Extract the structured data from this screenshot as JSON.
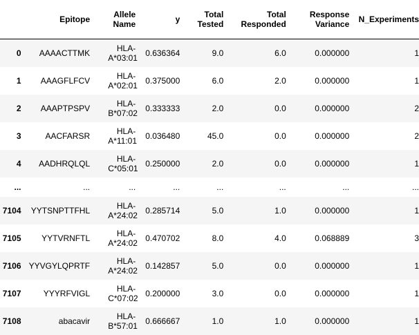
{
  "table": {
    "columns": [
      {
        "key": "index",
        "label": ""
      },
      {
        "key": "epitope",
        "label": "Epitope"
      },
      {
        "key": "allele_name",
        "label": "Allele Name"
      },
      {
        "key": "y",
        "label": "y"
      },
      {
        "key": "total_tested",
        "label": "Total Tested"
      },
      {
        "key": "total_responded",
        "label": "Total Responded"
      },
      {
        "key": "response_variance",
        "label": "Response Variance"
      },
      {
        "key": "n_experiments",
        "label": "N_Experiments"
      }
    ],
    "rows": [
      {
        "index": "0",
        "epitope": "AAAACTTMK",
        "allele_name": "HLA-A*03:01",
        "y": "0.636364",
        "total_tested": "9.0",
        "total_responded": "6.0",
        "response_variance": "0.000000",
        "n_experiments": "1"
      },
      {
        "index": "1",
        "epitope": "AAAGFLFCV",
        "allele_name": "HLA-A*02:01",
        "y": "0.375000",
        "total_tested": "6.0",
        "total_responded": "2.0",
        "response_variance": "0.000000",
        "n_experiments": "1"
      },
      {
        "index": "2",
        "epitope": "AAAPTPSPV",
        "allele_name": "HLA-B*07:02",
        "y": "0.333333",
        "total_tested": "2.0",
        "total_responded": "0.0",
        "response_variance": "0.000000",
        "n_experiments": "2"
      },
      {
        "index": "3",
        "epitope": "AACFARSR",
        "allele_name": "HLA-A*11:01",
        "y": "0.036480",
        "total_tested": "45.0",
        "total_responded": "0.0",
        "response_variance": "0.000000",
        "n_experiments": "2"
      },
      {
        "index": "4",
        "epitope": "AADHRQLQL",
        "allele_name": "HLA-C*05:01",
        "y": "0.250000",
        "total_tested": "2.0",
        "total_responded": "0.0",
        "response_variance": "0.000000",
        "n_experiments": "1"
      },
      {
        "index": "...",
        "epitope": "...",
        "allele_name": "...",
        "y": "...",
        "total_tested": "...",
        "total_responded": "...",
        "response_variance": "...",
        "n_experiments": "..."
      },
      {
        "index": "7104",
        "epitope": "YYTSNPTTFHL",
        "allele_name": "HLA-A*24:02",
        "y": "0.285714",
        "total_tested": "5.0",
        "total_responded": "1.0",
        "response_variance": "0.000000",
        "n_experiments": "1"
      },
      {
        "index": "7105",
        "epitope": "YYTVRNFTL",
        "allele_name": "HLA-A*24:02",
        "y": "0.470702",
        "total_tested": "8.0",
        "total_responded": "4.0",
        "response_variance": "0.068889",
        "n_experiments": "3"
      },
      {
        "index": "7106",
        "epitope": "YYVGYLQPRTF",
        "allele_name": "HLA-A*24:02",
        "y": "0.142857",
        "total_tested": "5.0",
        "total_responded": "0.0",
        "response_variance": "0.000000",
        "n_experiments": "1"
      },
      {
        "index": "7107",
        "epitope": "YYYRFVIGL",
        "allele_name": "HLA-C*07:02",
        "y": "0.200000",
        "total_tested": "3.0",
        "total_responded": "0.0",
        "response_variance": "0.000000",
        "n_experiments": "1"
      },
      {
        "index": "7108",
        "epitope": "abacavir",
        "allele_name": "HLA-B*57:01",
        "y": "0.666667",
        "total_tested": "1.0",
        "total_responded": "1.0",
        "response_variance": "0.000000",
        "n_experiments": "1"
      }
    ]
  }
}
